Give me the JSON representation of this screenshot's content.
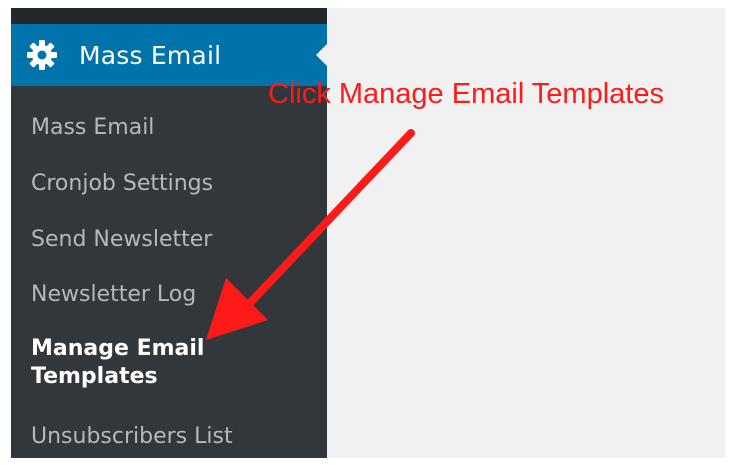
{
  "sidebar": {
    "header": {
      "title": "Mass Email",
      "icon": "gear-icon"
    },
    "items": [
      {
        "label": "Mass Email"
      },
      {
        "label": "Cronjob Settings"
      },
      {
        "label": "Send Newsletter"
      },
      {
        "label": "Newsletter Log"
      },
      {
        "label": "Manage Email Templates",
        "current": true
      },
      {
        "label": "Unsubscribers List"
      }
    ]
  },
  "annotation": {
    "text": "Click Manage Email Templates",
    "color": "#ff1a1a"
  },
  "colors": {
    "sidebar_bg": "#23282d",
    "submenu_bg": "#32373c",
    "active_header_bg": "#0073aa",
    "content_bg": "#f1f1f1",
    "submenu_text": "#b4b9be",
    "current_text": "#ffffff"
  }
}
